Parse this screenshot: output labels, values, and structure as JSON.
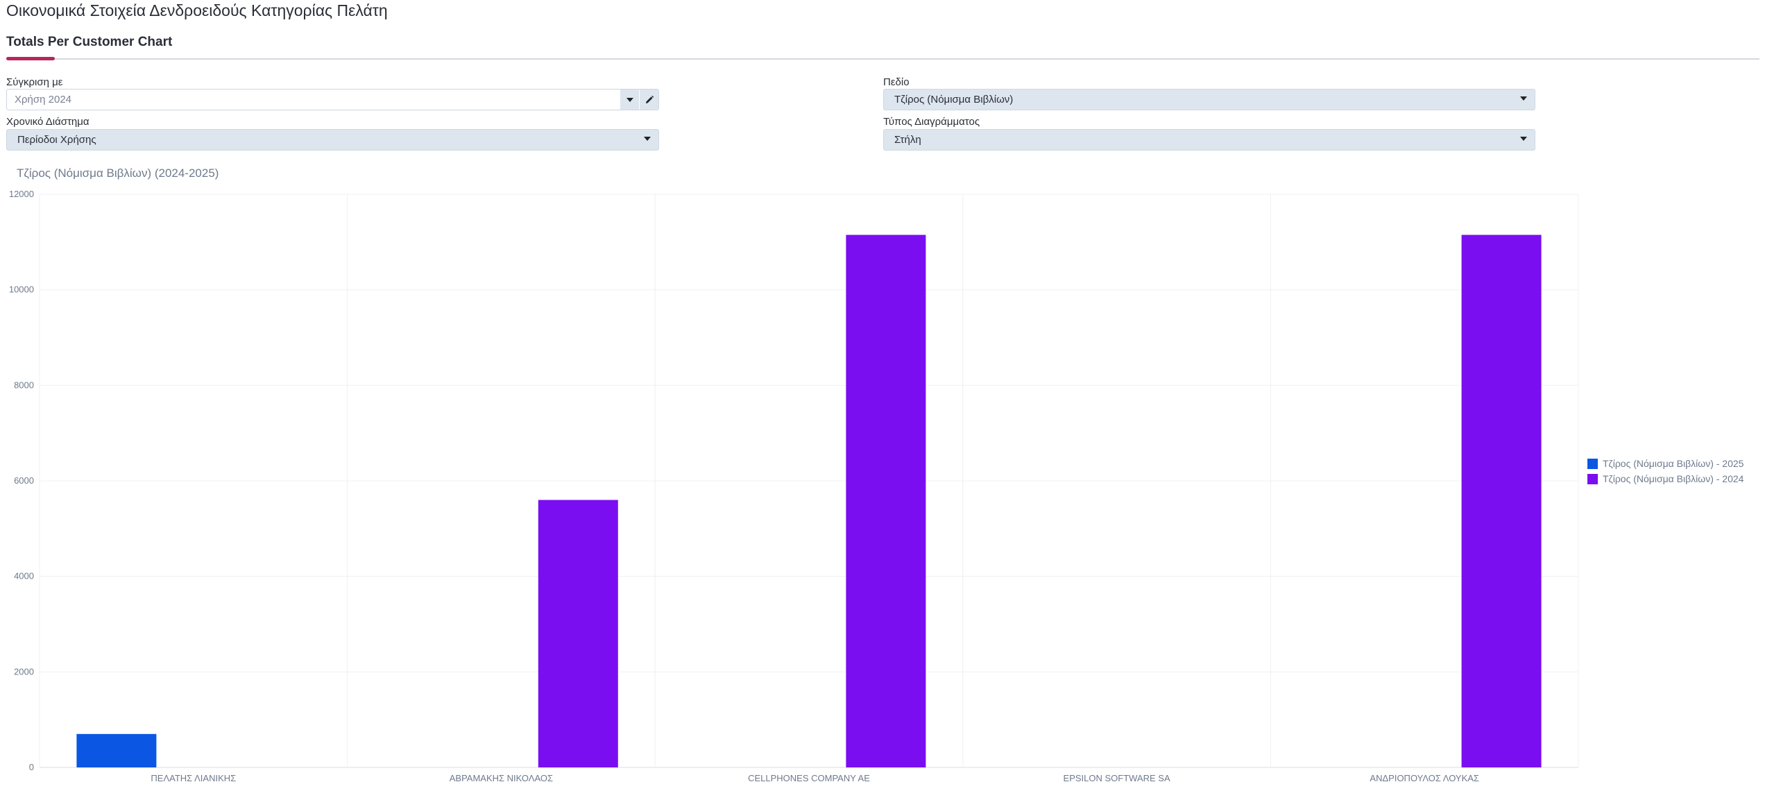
{
  "page": {
    "title": "Οικονομικά Στοιχεία Δενδροειδούς Κατηγορίας Πελάτη"
  },
  "tabs": [
    {
      "label": "Totals Per Customer Chart",
      "active": true
    }
  ],
  "filters": {
    "compare_with": {
      "label": "Σύγκριση με",
      "value": "Χρήση 2024",
      "icons": [
        "chevron-down-icon",
        "pencil-icon"
      ]
    },
    "time_range": {
      "label": "Χρονικό Διάστημα",
      "value": "Περίοδοι Χρήσης"
    },
    "field": {
      "label": "Πεδίο",
      "value": "Τζίρος (Νόμισμα Βιβλίων)"
    },
    "chart_type": {
      "label": "Τύπος Διαγράμματος",
      "value": "Στήλη"
    }
  },
  "colors": {
    "accent": "#b8255f",
    "series_2025": "#0b57e3",
    "series_2024": "#7a0ef0",
    "select_bg": "#dde5ef"
  },
  "chart_data": {
    "type": "bar",
    "title": "Τζίρος (Νόμισμα Βιβλίων) (2024-2025)",
    "categories": [
      "ΠΕΛΑΤΗΣ ΛΙΑΝΙΚΗΣ",
      "ΑΒΡΑΜΑΚΗΣ ΝΙΚΟΛΑΟΣ",
      "CELLPHONES COMPANY AE",
      "EPSILON SOFTWARE SA",
      "ΑΝΔΡΙΟΠΟΥΛΟΣ ΛΟΥΚΑΣ"
    ],
    "series": [
      {
        "name": "Τζίρος (Νόμισμα Βιβλίων) - 2025",
        "color": "#0b57e3",
        "values": [
          700,
          0,
          0,
          0,
          0
        ]
      },
      {
        "name": "Τζίρος (Νόμισμα Βιβλίων) - 2024",
        "color": "#7a0ef0",
        "values": [
          0,
          5600,
          11150,
          0,
          11150
        ]
      }
    ],
    "ylim": [
      0,
      12000
    ],
    "yticks": [
      0,
      2000,
      4000,
      6000,
      8000,
      10000,
      12000
    ],
    "grid": true,
    "legend_position": "right"
  }
}
